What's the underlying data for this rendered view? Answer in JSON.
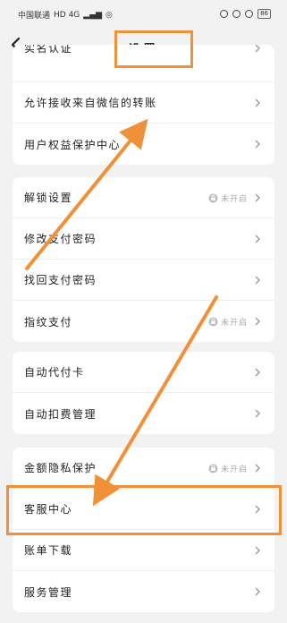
{
  "status_bar": {
    "carrier": "中国联通",
    "network": "HD 4G",
    "battery": "86"
  },
  "nav": {
    "title": "设置"
  },
  "group1": [
    {
      "label": "实名认证"
    },
    {
      "label": "允许接收来自微信的转账"
    },
    {
      "label": "用户权益保护中心"
    }
  ],
  "group2": [
    {
      "label": "解锁设置",
      "status": "未开启"
    },
    {
      "label": "修改支付密码"
    },
    {
      "label": "找回支付密码"
    },
    {
      "label": "指纹支付",
      "status": "未开启"
    }
  ],
  "group3": [
    {
      "label": "自动代付卡"
    },
    {
      "label": "自动扣费管理"
    }
  ],
  "group4": [
    {
      "label": "金额隐私保护",
      "status": "未开启"
    },
    {
      "label": "客服中心"
    },
    {
      "label": "账单下载"
    },
    {
      "label": "服务管理"
    }
  ],
  "colors": {
    "annotation": "#f0913a",
    "background": "#f2f2f2"
  }
}
